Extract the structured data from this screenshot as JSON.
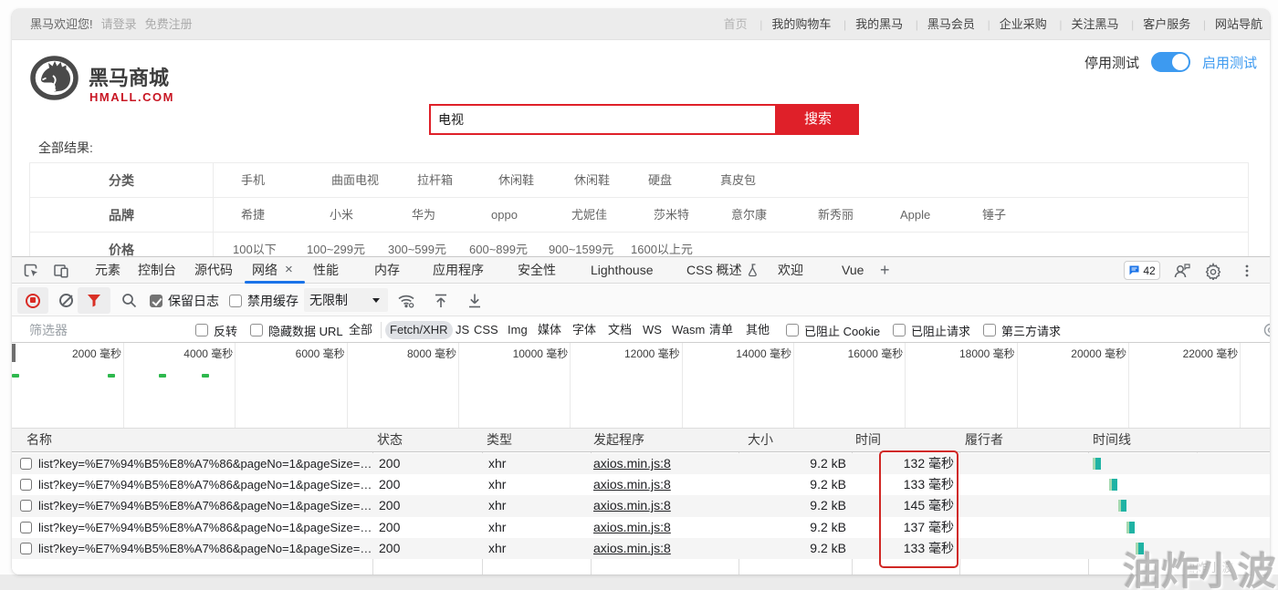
{
  "shop": {
    "topbar": {
      "welcome": "黑马欢迎您!",
      "login": "请登录",
      "register": "免费注册",
      "nav": [
        "首页",
        "我的购物车",
        "我的黑马",
        "黑马会员",
        "企业采购",
        "关注黑马",
        "客户服务",
        "网站导航"
      ]
    },
    "logo": {
      "name": "黑马商城",
      "domain": "HMALL.COM"
    },
    "test_toggle": {
      "off_label": "停用测试",
      "on_label": "启用测试",
      "state": "on"
    },
    "search": {
      "value": "电视",
      "button_label": "搜索"
    },
    "results_label": "全部结果:",
    "filter_rows": [
      {
        "label": "分类",
        "values": [
          "手机",
          "曲面电视",
          "拉杆箱",
          "休闲鞋",
          "休闲鞋",
          "硬盘",
          "真皮包"
        ]
      },
      {
        "label": "品牌",
        "values": [
          "希捷",
          "小米",
          "华为",
          "oppo",
          "尤妮佳",
          "莎米特",
          "意尔康",
          "新秀丽",
          "Apple",
          "锤子"
        ]
      },
      {
        "label": "价格",
        "values": [
          "100以下",
          "100~299元",
          "300~599元",
          "600~899元",
          "900~1599元",
          "1600以上元"
        ]
      }
    ]
  },
  "devtools": {
    "tabs": [
      "元素",
      "控制台",
      "源代码",
      "网络",
      "性能",
      "内存",
      "应用程序",
      "安全性",
      "Lighthouse",
      "CSS 概述",
      "欢迎",
      "Vue"
    ],
    "active_tab": "网络",
    "new_tab_label": "+",
    "close_tab_label": "×",
    "message_count": "42",
    "toolbar": {
      "preserve_log_label": "保留日志",
      "preserve_log_checked": true,
      "disable_cache_label": "禁用缓存",
      "disable_cache_checked": false,
      "throttling_value": "无限制"
    },
    "filterbar": {
      "placeholder": "筛选器",
      "invert_label": "反转",
      "hide_data_urls_label": "隐藏数据 URL",
      "types": [
        "全部",
        "Fetch/XHR",
        "JS",
        "CSS",
        "Img",
        "媒体",
        "字体",
        "文档",
        "WS",
        "Wasm",
        "清单",
        "其他"
      ],
      "active_type": "Fetch/XHR",
      "blocked_cookies_label": "已阻止 Cookie",
      "blocked_requests_label": "已阻止请求",
      "third_party_label": "第三方请求"
    },
    "ruler_labels": [
      "2000 毫秒",
      "4000 毫秒",
      "6000 毫秒",
      "8000 毫秒",
      "10000 毫秒",
      "12000 毫秒",
      "14000 毫秒",
      "16000 毫秒",
      "18000 毫秒",
      "20000 毫秒",
      "22000 毫秒"
    ],
    "table": {
      "columns": [
        "名称",
        "状态",
        "类型",
        "发起程序",
        "大小",
        "时间",
        "履行者",
        "时间线"
      ],
      "rows": [
        {
          "name": "list?key=%E7%94%B5%E8%A7%86&pageNo=1&pageSize=…",
          "status": "200",
          "type": "xhr",
          "initiator": "axios.min.js:8",
          "size": "9.2 kB",
          "time": "132 毫秒"
        },
        {
          "name": "list?key=%E7%94%B5%E8%A7%86&pageNo=1&pageSize=…",
          "status": "200",
          "type": "xhr",
          "initiator": "axios.min.js:8",
          "size": "9.2 kB",
          "time": "133 毫秒"
        },
        {
          "name": "list?key=%E7%94%B5%E8%A7%86&pageNo=1&pageSize=…",
          "status": "200",
          "type": "xhr",
          "initiator": "axios.min.js:8",
          "size": "9.2 kB",
          "time": "145 毫秒"
        },
        {
          "name": "list?key=%E7%94%B5%E8%A7%86&pageNo=1&pageSize=…",
          "status": "200",
          "type": "xhr",
          "initiator": "axios.min.js:8",
          "size": "9.2 kB",
          "time": "137 毫秒"
        },
        {
          "name": "list?key=%E7%94%B5%E8%A7%86&pageNo=1&pageSize=…",
          "status": "200",
          "type": "xhr",
          "initiator": "axios.min.js:8",
          "size": "9.2 kB",
          "time": "133 毫秒"
        }
      ]
    }
  },
  "watermark": {
    "text": "油炸小波",
    "sub_text": "油炸小波"
  },
  "colors": {
    "brand_red": "#df2029",
    "logo_domain_red": "#c81623",
    "toggle_blue": "#3d9af0",
    "devtools_accent_blue": "#1a73e8",
    "link_blue": "#1a56c4",
    "annotation_red": "#d02724",
    "overview_green": "#2db84d",
    "waterfall_teal": "#1fb3a4"
  }
}
